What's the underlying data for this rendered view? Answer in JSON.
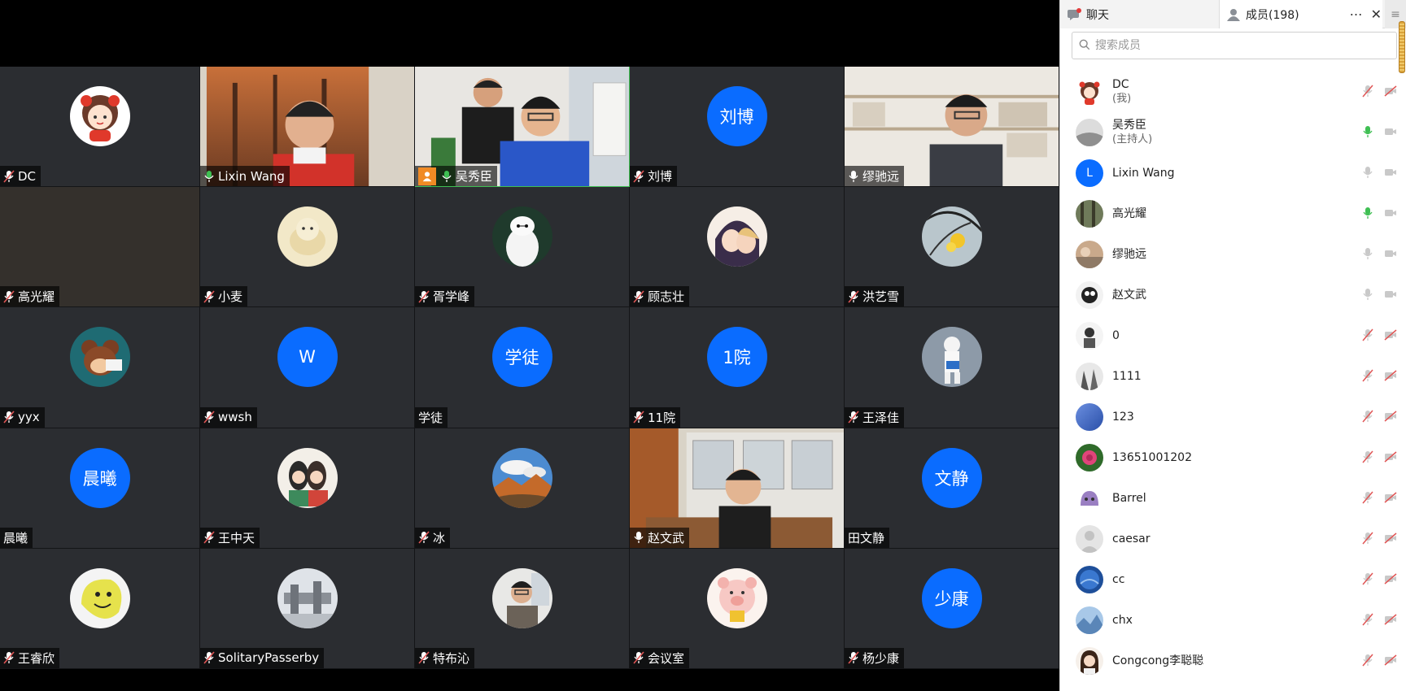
{
  "tabs": {
    "chat_label": "聊天",
    "members_label": "成员(198)"
  },
  "search": {
    "placeholder": "搜索成员"
  },
  "colors": {
    "accent": "#0a6cff",
    "mic_on": "#3fbf53",
    "mic_muted": "#e05656",
    "host_badge": "#f08a24"
  },
  "tiles": [
    {
      "name": "DC",
      "kind": "avatar",
      "mic": "muted"
    },
    {
      "name": "Lixin Wang",
      "kind": "video",
      "mic": "on"
    },
    {
      "name": "吴秀臣",
      "kind": "video",
      "mic": "on",
      "host": true,
      "active": true
    },
    {
      "name": "刘博",
      "kind": "letter",
      "letter": "刘博",
      "mic": "muted"
    },
    {
      "name": "缪驰远",
      "kind": "video",
      "mic": "on"
    },
    {
      "name": "高光耀",
      "kind": "dark",
      "mic": "muted"
    },
    {
      "name": "小麦",
      "kind": "avatar",
      "mic": "muted"
    },
    {
      "name": "胥学峰",
      "kind": "avatar",
      "mic": "muted"
    },
    {
      "name": "顾志壮",
      "kind": "avatar",
      "mic": "muted"
    },
    {
      "name": "洪艺雪",
      "kind": "avatar",
      "mic": "muted"
    },
    {
      "name": "yyx",
      "kind": "avatar",
      "mic": "muted"
    },
    {
      "name": "wwsh",
      "kind": "letter",
      "letter": "W",
      "mic": "muted"
    },
    {
      "name": "学徒",
      "kind": "letter",
      "letter": "学徒",
      "mic": "none"
    },
    {
      "name": "11院",
      "kind": "letter",
      "letter": "1院",
      "mic": "muted"
    },
    {
      "name": "王泽佳",
      "kind": "avatar",
      "mic": "muted"
    },
    {
      "name": "晨曦",
      "kind": "letter",
      "letter": "晨曦",
      "mic": "none"
    },
    {
      "name": "王中天",
      "kind": "avatar",
      "mic": "muted"
    },
    {
      "name": "冰",
      "kind": "avatar",
      "mic": "muted"
    },
    {
      "name": "赵文武",
      "kind": "video",
      "mic": "on"
    },
    {
      "name": "田文静",
      "kind": "letter",
      "letter": "文静",
      "mic": "none"
    },
    {
      "name": "王睿欣",
      "kind": "avatar",
      "mic": "muted"
    },
    {
      "name": "SolitaryPasserby",
      "kind": "avatar",
      "mic": "muted"
    },
    {
      "name": "特布沁",
      "kind": "avatar",
      "mic": "muted"
    },
    {
      "name": "会议室",
      "kind": "avatar",
      "mic": "muted"
    },
    {
      "name": "杨少康",
      "kind": "letter",
      "letter": "少康",
      "mic": "muted"
    }
  ],
  "members": [
    {
      "name": "DC",
      "role": "(我)",
      "mic": "muted",
      "cam": "off"
    },
    {
      "name": "吴秀臣",
      "role": "(主持人)",
      "mic": "on",
      "cam": "on"
    },
    {
      "name": "Lixin Wang",
      "role": "",
      "letter": "L",
      "mic": "idle",
      "cam": "on"
    },
    {
      "name": "高光耀",
      "role": "",
      "mic": "on",
      "cam": "on"
    },
    {
      "name": "缪驰远",
      "role": "",
      "mic": "idle",
      "cam": "on"
    },
    {
      "name": "赵文武",
      "role": "",
      "mic": "idle",
      "cam": "on"
    },
    {
      "name": "0",
      "role": "",
      "mic": "muted",
      "cam": "off"
    },
    {
      "name": "1111",
      "role": "",
      "mic": "muted",
      "cam": "off"
    },
    {
      "name": "123",
      "role": "",
      "mic": "muted",
      "cam": "off"
    },
    {
      "name": "13651001202",
      "role": "",
      "mic": "muted",
      "cam": "off"
    },
    {
      "name": "Barrel",
      "role": "",
      "mic": "muted",
      "cam": "off"
    },
    {
      "name": "caesar",
      "role": "",
      "mic": "muted",
      "cam": "off"
    },
    {
      "name": "cc",
      "role": "",
      "mic": "muted",
      "cam": "off"
    },
    {
      "name": "chx",
      "role": "",
      "mic": "muted",
      "cam": "off"
    },
    {
      "name": "Congcong李聪聪",
      "role": "",
      "mic": "muted",
      "cam": "off"
    }
  ]
}
